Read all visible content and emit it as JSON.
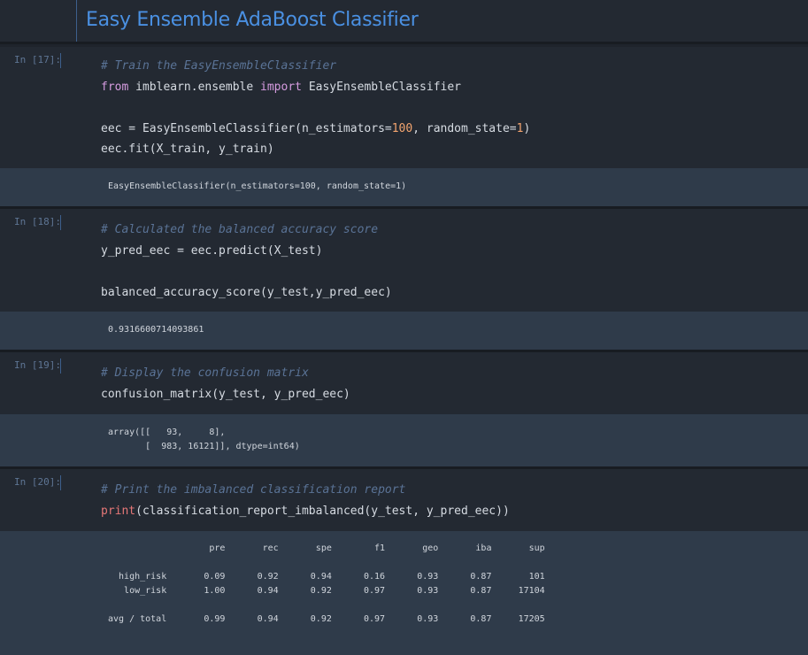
{
  "header": {
    "title": "Easy Ensemble AdaBoost Classifier"
  },
  "cells": [
    {
      "prompt": "In [17]:",
      "lines": [
        {
          "parts": [
            {
              "t": "# Train the EasyEnsembleClassifier",
              "k": "c"
            }
          ]
        },
        {
          "parts": [
            {
              "t": "from",
              "k": "kw"
            },
            {
              "t": " imblearn.ensemble ",
              "k": ""
            },
            {
              "t": "import",
              "k": "kw"
            },
            {
              "t": " EasyEnsembleClassifier",
              "k": ""
            }
          ]
        },
        {
          "parts": [
            {
              "t": "",
              "k": ""
            }
          ]
        },
        {
          "parts": [
            {
              "t": "eec = EasyEnsembleClassifier(n_estimators=",
              "k": ""
            },
            {
              "t": "100",
              "k": "num"
            },
            {
              "t": ", random_state=",
              "k": ""
            },
            {
              "t": "1",
              "k": "num"
            },
            {
              "t": ")",
              "k": ""
            }
          ]
        },
        {
          "parts": [
            {
              "t": "eec.fit(X_train, y_train)",
              "k": ""
            }
          ]
        }
      ],
      "output": "EasyEnsembleClassifier(n_estimators=100, random_state=1)"
    },
    {
      "prompt": "In [18]:",
      "lines": [
        {
          "parts": [
            {
              "t": "# Calculated the balanced accuracy score",
              "k": "c"
            }
          ]
        },
        {
          "parts": [
            {
              "t": "y_pred_eec = eec.predict(X_test)",
              "k": ""
            }
          ]
        },
        {
          "parts": [
            {
              "t": "",
              "k": ""
            }
          ]
        },
        {
          "parts": [
            {
              "t": "balanced_accuracy_score(y_test,y_pred_eec)",
              "k": ""
            }
          ]
        }
      ],
      "output": "0.9316600714093861"
    },
    {
      "prompt": "In [19]:",
      "lines": [
        {
          "parts": [
            {
              "t": "# Display the confusion matrix",
              "k": "c"
            }
          ]
        },
        {
          "parts": [
            {
              "t": "confusion_matrix(y_test, y_pred_eec)",
              "k": ""
            }
          ]
        }
      ],
      "output": "array([[   93,     8],\n       [  983, 16121]], dtype=int64)"
    },
    {
      "prompt": "In [20]:",
      "lines": [
        {
          "parts": [
            {
              "t": "# Print the imbalanced classification report",
              "k": "c"
            }
          ]
        },
        {
          "parts": [
            {
              "t": "print",
              "k": "bi"
            },
            {
              "t": "(classification_report_imbalanced(y_test, y_pred_eec))",
              "k": ""
            }
          ]
        }
      ],
      "output": "                   pre       rec       spe        f1       geo       iba       sup\n\n  high_risk       0.09      0.92      0.94      0.16      0.93      0.87       101\n   low_risk       1.00      0.94      0.92      0.97      0.93      0.87     17104\n\navg / total       0.99      0.94      0.92      0.97      0.93      0.87     17205"
    }
  ],
  "colors": {
    "background": "#1f242c",
    "cell": "#232932",
    "output": "#2f3b4a",
    "title": "#4a90e2",
    "comment": "#5a7396",
    "keyword": "#d69ce0",
    "builtin": "#e57777",
    "number": "#f2a46f"
  }
}
